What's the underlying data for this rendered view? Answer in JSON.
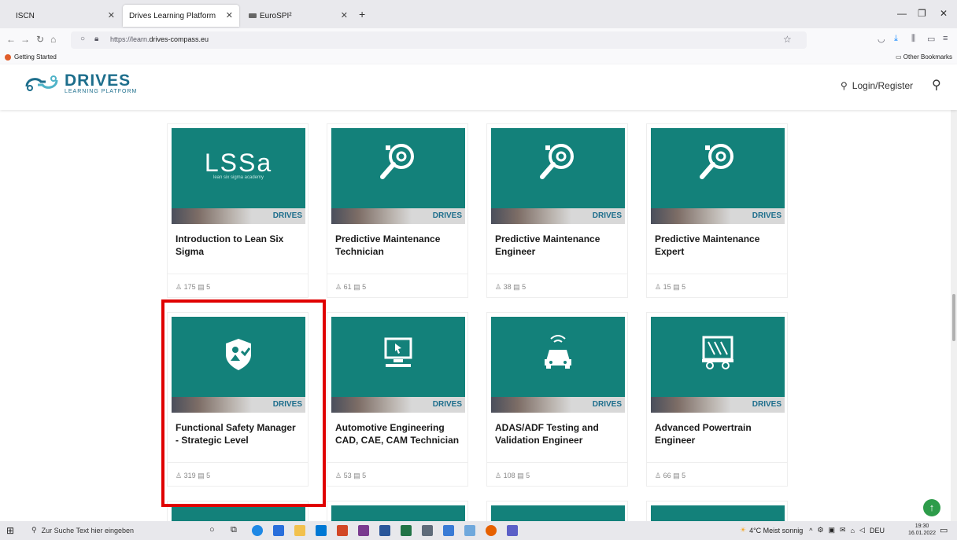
{
  "browser": {
    "tabs": [
      {
        "label": "ISCN"
      },
      {
        "label": "Drives Learning Platform"
      },
      {
        "label": "EuroSPI²"
      }
    ],
    "url_prefix": "https://learn.",
    "url_domain": "drives-compass.eu",
    "bookmarks": {
      "left": "Getting Started",
      "right": "Other Bookmarks"
    }
  },
  "site": {
    "logo_title": "DRIVES",
    "logo_subtitle": "LEARNING PLATFORM",
    "login_label": "Login/Register"
  },
  "courses": [
    {
      "title": "Introduction to Lean Six Sigma",
      "learners": "175",
      "lessons": "5",
      "image": "lssa-logo",
      "lssa_text": "LSSa",
      "lssa_sub": "lean six sigma academy",
      "brand": "DRIVES"
    },
    {
      "title": "Predictive Maintenance Technician",
      "learners": "61",
      "lessons": "5",
      "image": "magnifier-gear-icon",
      "brand": "DRIVES"
    },
    {
      "title": "Predictive Maintenance Engineer",
      "learners": "38",
      "lessons": "5",
      "image": "magnifier-gear-icon",
      "brand": "DRIVES"
    },
    {
      "title": "Predictive Maintenance Expert",
      "learners": "15",
      "lessons": "5",
      "image": "magnifier-gear-icon",
      "brand": "DRIVES"
    },
    {
      "title": "Functional Safety Manager - Strategic Level",
      "learners": "319",
      "lessons": "5",
      "image": "safety-shield-person-icon",
      "brand": "DRIVES"
    },
    {
      "title": "Automotive Engineering CAD, CAE, CAM Technician",
      "learners": "53",
      "lessons": "5",
      "image": "computer-monitor-icon",
      "brand": "DRIVES"
    },
    {
      "title": "ADAS/ADF Testing and Validation Engineer",
      "learners": "108",
      "lessons": "5",
      "image": "autonomous-car-icon",
      "brand": "DRIVES"
    },
    {
      "title": "Advanced Powertrain Engineer",
      "learners": "66",
      "lessons": "5",
      "image": "battery-vehicle-icon",
      "brand": "DRIVES"
    }
  ],
  "taskbar": {
    "search_placeholder": "Zur Suche Text hier eingeben",
    "weather": "4°C Meist sonnig",
    "language": "DEU",
    "time": "19:30",
    "date": "16.01.2022"
  },
  "colors": {
    "card_teal": "#13817a",
    "brand_blue": "#1d6e8c",
    "highlight_red": "#e00000",
    "scroll_top_green": "#2d9c4a"
  }
}
